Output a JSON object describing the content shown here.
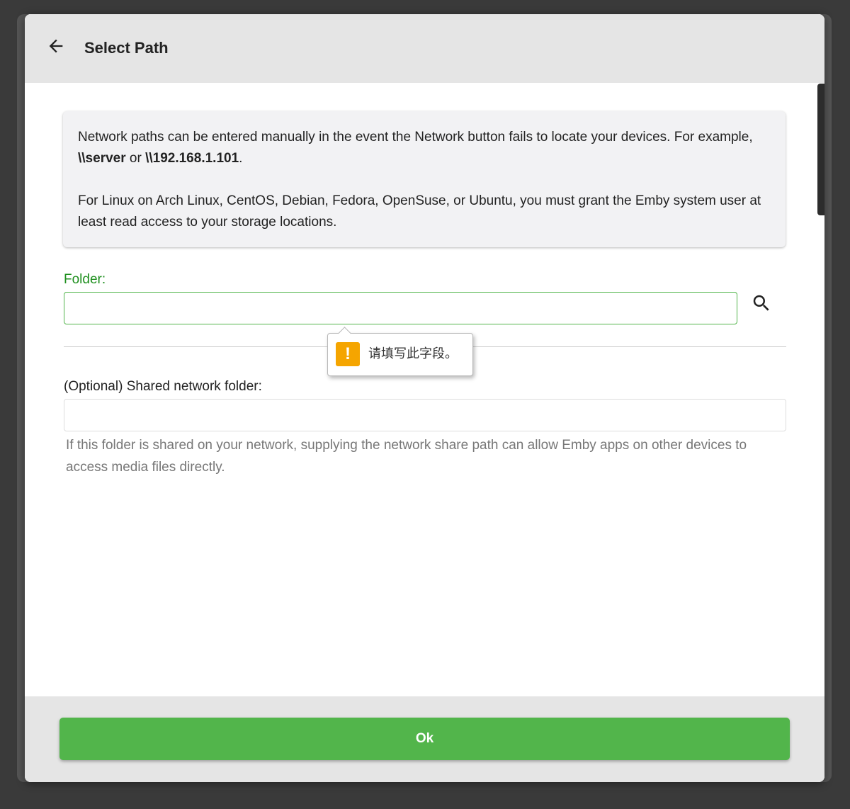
{
  "dialog": {
    "title": "Select Path",
    "back_icon": "arrow-left-icon"
  },
  "info": {
    "paragraph1": {
      "before": "Network paths can be entered manually in the event the Network button fails to locate your devices. For example, ",
      "example1": "\\\\server",
      "middle": " or ",
      "example2": "\\\\192.168.1.101",
      "after": "."
    },
    "paragraph2": "For Linux on Arch Linux, CentOS, Debian, Fedora, OpenSuse, or Ubuntu, you must grant the Emby system user at least read access to your storage locations."
  },
  "folder": {
    "label": "Folder:",
    "value": "",
    "search_icon": "search-icon"
  },
  "validation": {
    "message": "请填写此字段。",
    "icon": "warning-icon",
    "icon_glyph": "!"
  },
  "shared_folder": {
    "label": "(Optional) Shared network folder:",
    "value": "",
    "help": "If this folder is shared on your network, supplying the network share path can allow Emby apps on other devices to access media files directly."
  },
  "footer": {
    "ok_label": "Ok"
  },
  "colors": {
    "accent": "#52b54b",
    "label_green": "#1e8f1e",
    "warning": "#f5a500",
    "header_bg": "#e5e5e5"
  }
}
